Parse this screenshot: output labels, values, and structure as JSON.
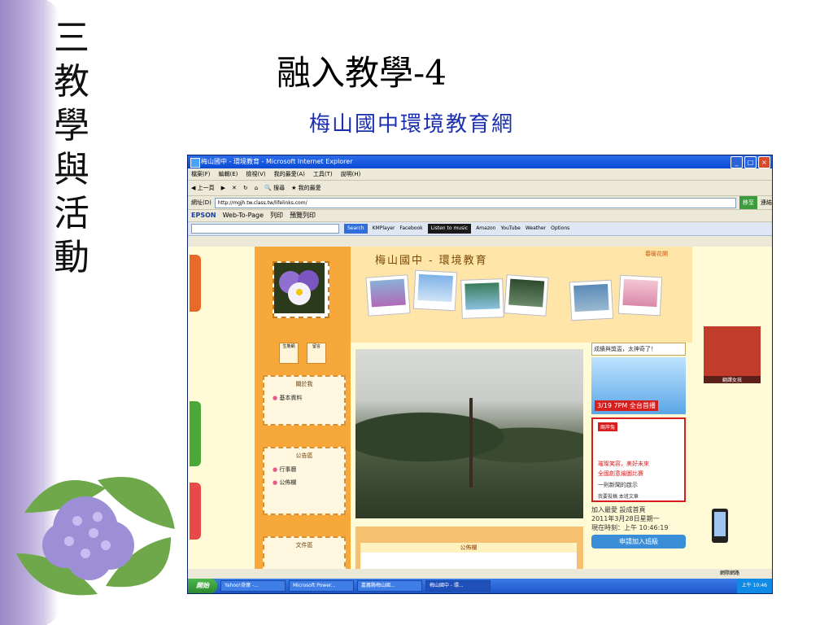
{
  "slide": {
    "vertical_title": [
      "三",
      "教",
      "學",
      "與",
      "活",
      "動"
    ],
    "title": "融入教學-4",
    "subtitle": "梅山國中環境教育網"
  },
  "window": {
    "title": "梅山國中 - 環境教育 - Microsoft Internet Explorer",
    "buttons": [
      "_",
      "□",
      "×"
    ],
    "menu": [
      "檔案(F)",
      "編輯(E)",
      "檢視(V)",
      "我的最愛(A)",
      "工具(T)",
      "說明(H)"
    ],
    "toolbar": [
      "上一頁",
      "搜尋",
      "我的最愛"
    ],
    "address_label": "網址(D)",
    "address_value": "http://mgjh.tw.class.tw/lifelinks.com/",
    "go_label": "移至",
    "links_label": "連結",
    "epson": "EPSON",
    "web_to_page": "Web-To-Page",
    "print_label": "列印",
    "preview_label": "預覽列印",
    "google": {
      "search_label": "Search",
      "kmplayer": "KMPlayer",
      "facebook": "Facebook",
      "music": "Listen to music",
      "amazon": "Amazon",
      "youtube": "YouTube",
      "weather": "Weather",
      "options": "Options"
    }
  },
  "site": {
    "banner_title": "梅山國中 - 環境教育",
    "banner_deco": "春暖花開",
    "icons": [
      "生態網",
      "留言"
    ],
    "boxes": [
      {
        "head": "關於我",
        "items": [
          "基本資料"
        ]
      },
      {
        "head": "公告區",
        "items": [
          "行事曆",
          "公佈欄"
        ]
      },
      {
        "head": "文件區",
        "items": []
      }
    ],
    "notice_head": "公佈欄",
    "right": {
      "top_title": "成績與獎盃，太神奇了！",
      "comic_caption": "3/19 7PM 全台首播",
      "rabbit_tag": "兩岸兔",
      "rabbit_line1": "璀璨笑容，美好未來",
      "rabbit_line2": "全國創意繪圖比賽",
      "rabbit_line3": "一則新聞的啟示",
      "rabbit_line4": "我要投稿  本班文章",
      "fav_line": "加入最愛  設成首頁",
      "date_line": "2011年3月28日星期一",
      "time_line": "現在時刻：上午 10:46:19",
      "join_label": "申請加入班級"
    },
    "avatar_caption": "翻譯女孩"
  },
  "status": {
    "text": "網際網路"
  },
  "taskbar": {
    "start": "開始",
    "items": [
      "Yahoo!奇摩 -...",
      "Microsoft Power...",
      "嘉義縣梅山國...",
      "梅山國中 - 環..."
    ],
    "clock": "上午 10:46"
  }
}
